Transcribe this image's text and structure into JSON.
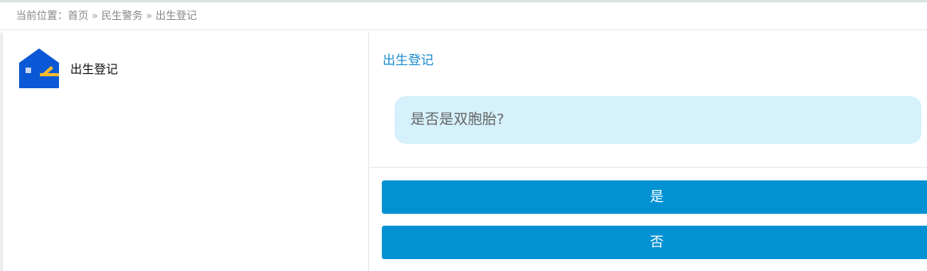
{
  "breadcrumb": {
    "prefix": "当前位置：",
    "items": [
      "首页",
      "民生警务",
      "出生登记"
    ],
    "separator": "»"
  },
  "service": {
    "label": "出生登记",
    "icon": "house-icon"
  },
  "panel": {
    "title": "出生登记",
    "question": "是否是双胞胎?"
  },
  "answers": {
    "yes_label": "是",
    "no_label": "否"
  },
  "colors": {
    "accent": "#0292d3",
    "title": "#1a8ad0",
    "bubble": "#d5f1fb",
    "icon_blue": "#0a58d6",
    "icon_yellow": "#f5b82e"
  }
}
